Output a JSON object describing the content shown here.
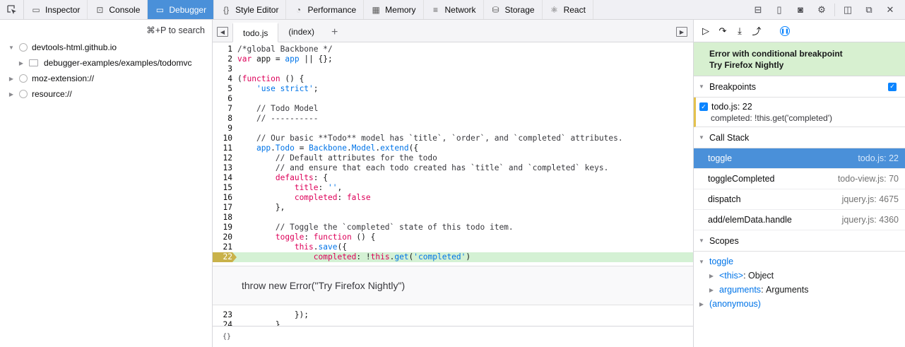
{
  "toolbar": {
    "pick_icon": "element-picker-icon",
    "tabs": [
      {
        "label": "Inspector",
        "icon": "inspector-icon"
      },
      {
        "label": "Console",
        "icon": "console-icon"
      },
      {
        "label": "Debugger",
        "icon": "debugger-icon"
      },
      {
        "label": "Style Editor",
        "icon": "braces-icon"
      },
      {
        "label": "Performance",
        "icon": "performance-icon"
      },
      {
        "label": "Memory",
        "icon": "memory-icon"
      },
      {
        "label": "Network",
        "icon": "network-icon"
      },
      {
        "label": "Storage",
        "icon": "storage-icon"
      },
      {
        "label": "React",
        "icon": "react-icon"
      }
    ],
    "active_tab": "Debugger",
    "right_icons": [
      "frames-icon",
      "responsive-icon",
      "screenshot-icon",
      "settings-icon",
      "dock-side-icon",
      "undock-icon",
      "close-icon"
    ]
  },
  "sources": {
    "search_hint": "⌘+P to search",
    "tree": [
      {
        "label": "devtools-html.github.io",
        "expanded": true,
        "depth": 0
      },
      {
        "label": "debugger-examples/examples/todomvc",
        "depth": 1
      },
      {
        "label": "moz-extension://",
        "expanded": false,
        "depth": 0
      },
      {
        "label": "resource://",
        "expanded": false,
        "depth": 0
      }
    ]
  },
  "editor": {
    "tabs": [
      {
        "label": "todo.js",
        "active": true
      },
      {
        "label": "(index)",
        "active": false
      }
    ],
    "lines": [
      {
        "n": "1"
      },
      {
        "n": "2"
      },
      {
        "n": "3"
      },
      {
        "n": "4"
      },
      {
        "n": "5"
      },
      {
        "n": "6"
      },
      {
        "n": "7"
      },
      {
        "n": "8"
      },
      {
        "n": "9"
      },
      {
        "n": "10"
      },
      {
        "n": "11"
      },
      {
        "n": "12"
      },
      {
        "n": "13"
      },
      {
        "n": "14"
      },
      {
        "n": "15"
      },
      {
        "n": "16"
      },
      {
        "n": "17"
      },
      {
        "n": "18"
      },
      {
        "n": "19"
      },
      {
        "n": "20"
      },
      {
        "n": "21"
      },
      {
        "n": "22"
      }
    ],
    "code": [
      "/*global Backbone */",
      "var app = app || {};",
      "",
      "(function () {",
      "    'use strict';",
      "",
      "    // Todo Model",
      "    // ----------",
      "",
      "    // Our basic **Todo** model has `title`, `order`, and `completed` attributes.",
      "    app.Todo = Backbone.Model.extend({",
      "        // Default attributes for the todo",
      "        // and ensure that each todo created has `title` and `completed` keys.",
      "        defaults: {",
      "            title: '',",
      "            completed: false",
      "        },",
      "",
      "        // Toggle the `completed` state of this todo item.",
      "        toggle: function () {",
      "            this.save({",
      "                completed: !this.get('completed')"
    ],
    "paused_line": "22",
    "error_message": "throw new Error(\"Try Firefox Nightly\")",
    "after_lines": [
      {
        "n": "23",
        "code": "            });"
      },
      {
        "n": "24",
        "code": "        },"
      }
    ],
    "footer_symbol": "{}"
  },
  "debug": {
    "pause_banner": {
      "line1": "Error with conditional breakpoint",
      "line2": "Try Firefox Nightly"
    },
    "breakpoints": {
      "title": "Breakpoints",
      "items": [
        {
          "location": "todo.js: 22",
          "condition": "completed: !this.get('completed')"
        }
      ]
    },
    "call_stack": {
      "title": "Call Stack",
      "frames": [
        {
          "name": "toggle",
          "loc": "todo.js: 22",
          "selected": true
        },
        {
          "name": "toggleCompleted",
          "loc": "todo-view.js: 70"
        },
        {
          "name": "dispatch",
          "loc": "jquery.js: 4675"
        },
        {
          "name": "add/elemData.handle",
          "loc": "jquery.js: 4360"
        }
      ]
    },
    "scopes": {
      "title": "Scopes",
      "root": "toggle",
      "vars": [
        {
          "name": "<this>",
          "value": "Object"
        },
        {
          "name": "arguments",
          "value": "Arguments"
        }
      ],
      "anonymous": "(anonymous)"
    }
  }
}
